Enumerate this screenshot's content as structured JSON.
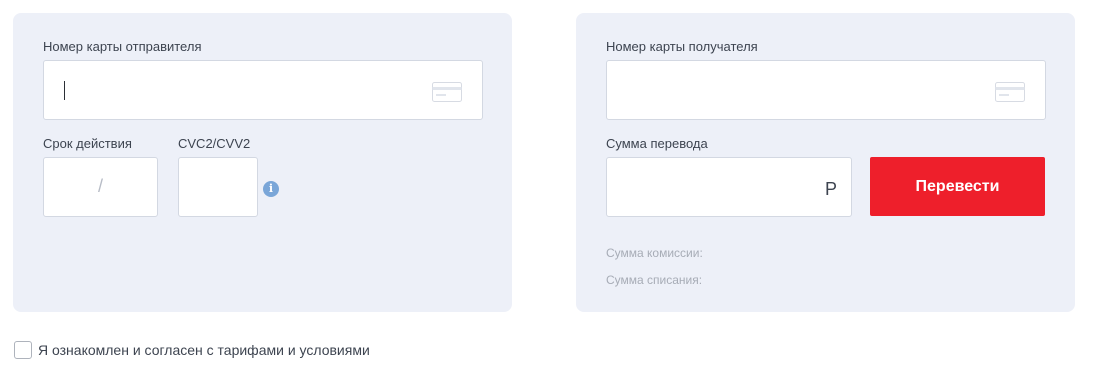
{
  "sender": {
    "card_label": "Номер карты отправителя",
    "card_value": "",
    "expiry_label": "Срок действия",
    "expiry_separator": "/",
    "cvc_label": "CVC2/CVV2",
    "info_glyph": "i"
  },
  "recipient": {
    "card_label": "Номер карты получателя",
    "card_value": "",
    "amount_label": "Сумма перевода",
    "currency": "Р",
    "commission_label": "Сумма комиссии:",
    "debit_label": "Сумма списания:"
  },
  "actions": {
    "transfer_label": "Перевести"
  },
  "agreement": {
    "label": "Я ознакомлен и согласен с тарифами и условиями",
    "checked": false
  },
  "colors": {
    "panel_bg": "#edf0f8",
    "accent": "#ee1f2b",
    "info": "#7aa6d8"
  }
}
